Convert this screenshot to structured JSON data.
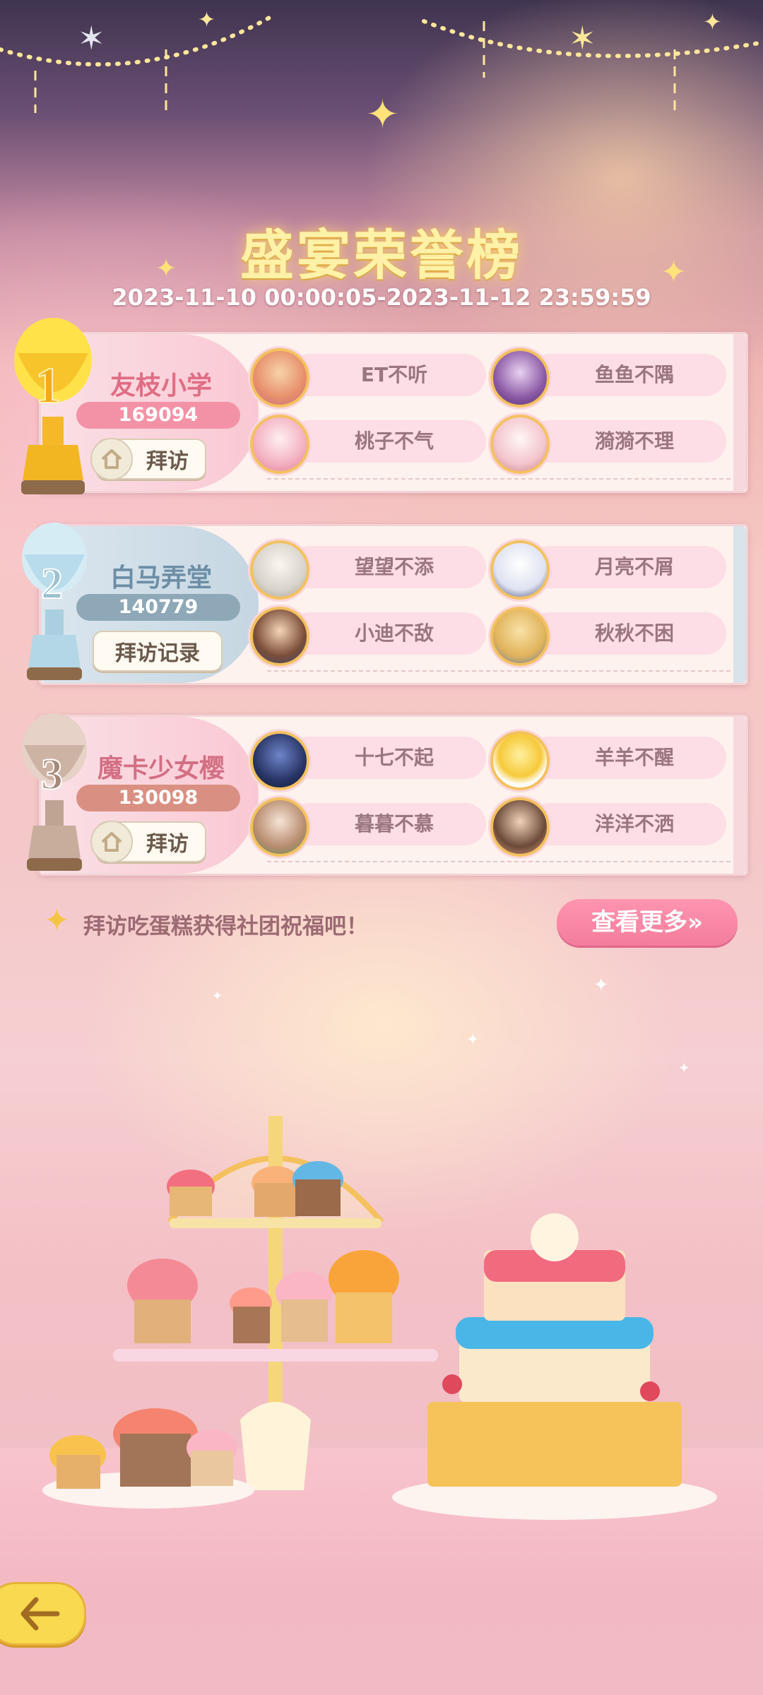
{
  "title": "盛宴荣誉榜",
  "date_range": "2023-11-10 00:00:05-2023-11-12 23:59:59",
  "ranks": [
    {
      "rank": "1",
      "club": "友枝小学",
      "score": "169094",
      "button": "拜访",
      "members": [
        "ET不听",
        "鱼鱼不隅",
        "桃子不气",
        "漪漪不理"
      ]
    },
    {
      "rank": "2",
      "club": "白马弄堂",
      "score": "140779",
      "button": "拜访记录",
      "members": [
        "望望不添",
        "月亮不屑",
        "小迪不敌",
        "秋秋不困"
      ]
    },
    {
      "rank": "3",
      "club": "魔卡少女樱",
      "score": "130098",
      "button": "拜访",
      "members": [
        "十七不起",
        "羊羊不醒",
        "暮暮不慕",
        "洋洋不洒"
      ]
    }
  ],
  "tip": "拜访吃蛋糕获得社团祝福吧！",
  "more_button": "查看更多»",
  "colors": {
    "gold": "#f4c15e",
    "pink_pill": "#fddde6",
    "more_btn": "#f47c9c",
    "back_btn": "#f8d94f"
  },
  "icons": [
    "home-icon",
    "member-badge-icon",
    "sparkle-icon",
    "back-arrow-icon",
    "trophy-gold-icon",
    "trophy-silver-icon",
    "trophy-bronze-icon"
  ]
}
